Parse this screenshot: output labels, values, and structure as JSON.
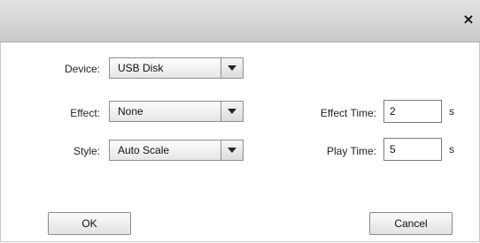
{
  "dialog": {
    "close_symbol": "×",
    "device_label": "Device:",
    "device_value": "USB Disk",
    "effect_label": "Effect:",
    "effect_value": "None",
    "style_label": "Style:",
    "style_value": "Auto Scale",
    "effect_time_label": "Effect Time:",
    "effect_time_value": "2",
    "effect_time_unit": "s",
    "play_time_label": "Play Time:",
    "play_time_value": "5",
    "play_time_unit": "s",
    "ok_label": "OK",
    "cancel_label": "Cancel"
  }
}
